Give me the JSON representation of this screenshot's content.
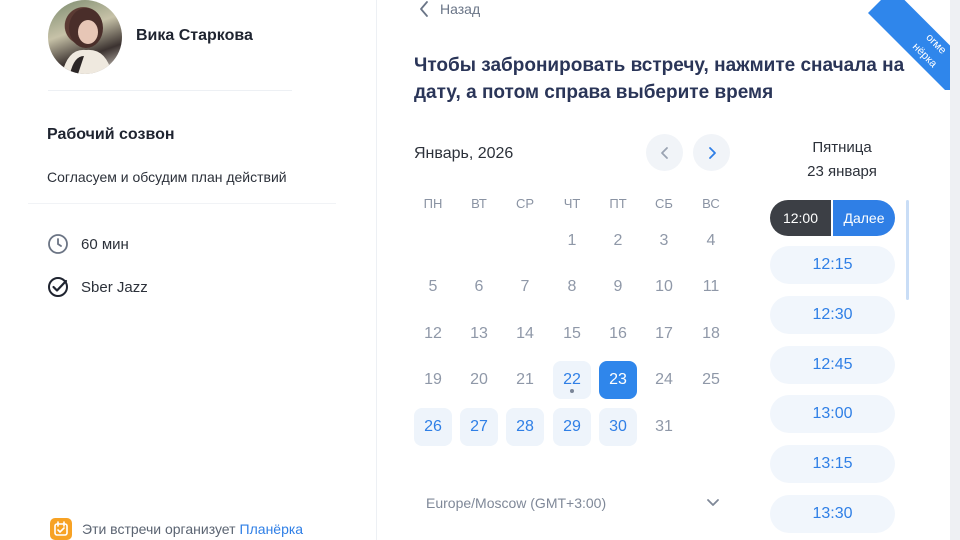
{
  "host": {
    "name": "Вика Старкова"
  },
  "event": {
    "title": "Рабочий созвон",
    "description": "Согласуем и обсудим план действий",
    "duration": "60 мин",
    "platform": "Sber Jazz"
  },
  "organizer": {
    "text": "Эти встречи организует",
    "link": "Планёрка"
  },
  "nav": {
    "back": "Назад"
  },
  "instruction": "Чтобы забронировать встречу, нажмите сначала на дату, а потом справа выберите время",
  "calendar": {
    "month": "Январь, 2026",
    "weekdays": [
      "ПН",
      "ВТ",
      "СР",
      "ЧТ",
      "ПТ",
      "СБ",
      "ВС"
    ],
    "days": [
      {
        "n": "1",
        "state": "off"
      },
      {
        "n": "2",
        "state": "off"
      },
      {
        "n": "3",
        "state": "off"
      },
      {
        "n": "4",
        "state": "off"
      },
      {
        "n": "5",
        "state": "off"
      },
      {
        "n": "6",
        "state": "off"
      },
      {
        "n": "7",
        "state": "off"
      },
      {
        "n": "8",
        "state": "off"
      },
      {
        "n": "9",
        "state": "off"
      },
      {
        "n": "10",
        "state": "off"
      },
      {
        "n": "11",
        "state": "off"
      },
      {
        "n": "12",
        "state": "off"
      },
      {
        "n": "13",
        "state": "off"
      },
      {
        "n": "14",
        "state": "off"
      },
      {
        "n": "15",
        "state": "off"
      },
      {
        "n": "16",
        "state": "off"
      },
      {
        "n": "17",
        "state": "off"
      },
      {
        "n": "18",
        "state": "off"
      },
      {
        "n": "19",
        "state": "off"
      },
      {
        "n": "20",
        "state": "off"
      },
      {
        "n": "21",
        "state": "off"
      },
      {
        "n": "22",
        "state": "avail",
        "today": true
      },
      {
        "n": "23",
        "state": "selected"
      },
      {
        "n": "24",
        "state": "off"
      },
      {
        "n": "25",
        "state": "off"
      },
      {
        "n": "26",
        "state": "avail"
      },
      {
        "n": "27",
        "state": "avail"
      },
      {
        "n": "28",
        "state": "avail"
      },
      {
        "n": "29",
        "state": "avail"
      },
      {
        "n": "30",
        "state": "avail"
      },
      {
        "n": "31",
        "state": "off"
      }
    ],
    "timezone": "Europe/Moscow (GMT+3:00)"
  },
  "slots": {
    "weekday": "Пятница",
    "date": "23 января",
    "selected_time": "12:00",
    "next_label": "Далее",
    "times": [
      "12:15",
      "12:30",
      "12:45",
      "13:00",
      "13:15",
      "13:30"
    ]
  },
  "ribbon": {
    "line1": "оrме",
    "line2": "нёрка"
  },
  "colors": {
    "accent": "#2f7fe6",
    "selected_day": "#2f86eb",
    "dark_slot": "#3c3f45"
  }
}
